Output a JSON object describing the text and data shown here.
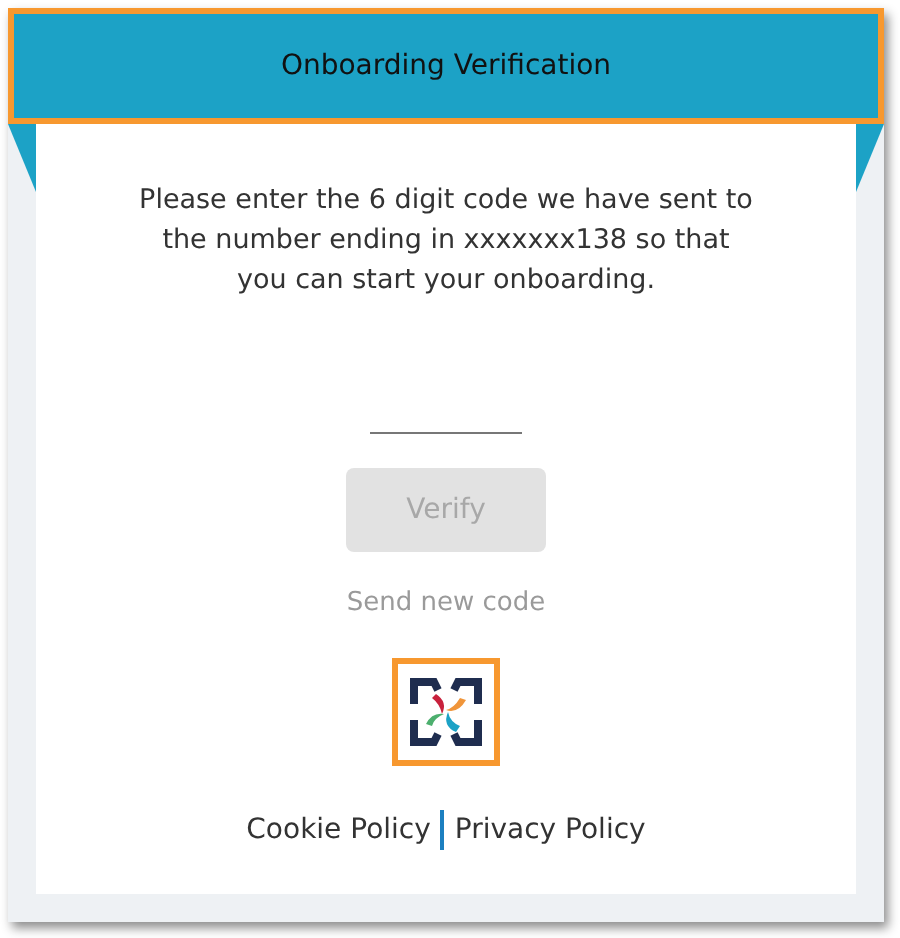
{
  "header": {
    "title": "Onboarding Verification",
    "highlighted": true
  },
  "message": "Please enter the 6 digit code we have sent to the number ending in xxxxxxx138 so that you can start your onboarding.",
  "verify_button": {
    "label": "Verify",
    "disabled": true
  },
  "resend_link": "Send new code",
  "logo": {
    "highlighted": true
  },
  "footer_links": [
    "Cookie Policy",
    "Privacy Policy"
  ]
}
